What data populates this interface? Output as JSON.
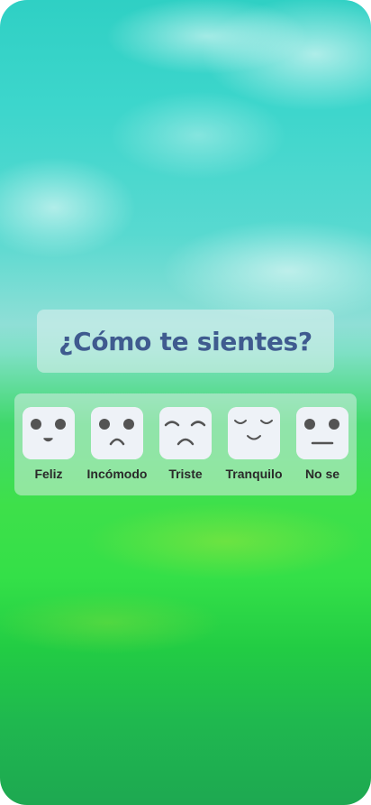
{
  "question": {
    "title": "¿Cómo te sientes?"
  },
  "moods": [
    {
      "label": "Feliz",
      "icon": "happy-face-icon"
    },
    {
      "label": "Incómodo",
      "icon": "uncomfortable-face-icon"
    },
    {
      "label": "Triste",
      "icon": "sad-face-icon"
    },
    {
      "label": "Tranquilo",
      "icon": "calm-face-icon"
    },
    {
      "label": "No se",
      "icon": "neutral-face-icon"
    }
  ],
  "colors": {
    "title": "#3f5b8f",
    "face_tile": "#eef2f7",
    "face_features": "#545454",
    "label": "#2a2a2a"
  }
}
